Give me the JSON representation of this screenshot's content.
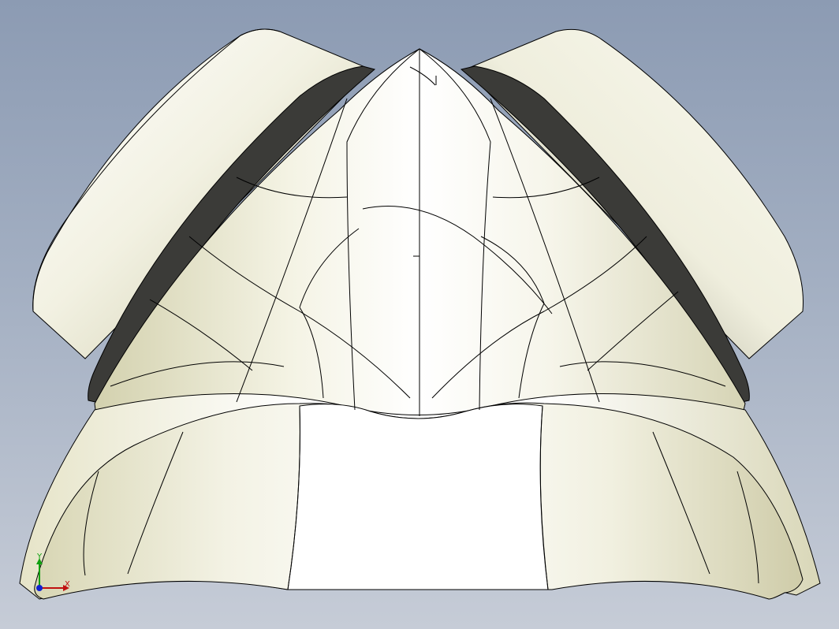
{
  "viewport": {
    "background_top": "#8c9bb3",
    "background_bottom": "#c6ccd7",
    "model": {
      "description_icon": "cad-solid-model-icon",
      "body_color": "#f2f0df",
      "shade_color": "#cfcca8",
      "edge_color": "#000000",
      "flange_color": "#3a3a38"
    },
    "triad": {
      "x_label": "X",
      "y_label": "Y",
      "x_color": "#c01010",
      "y_color": "#10a010",
      "z_color": "#1020d0"
    }
  }
}
